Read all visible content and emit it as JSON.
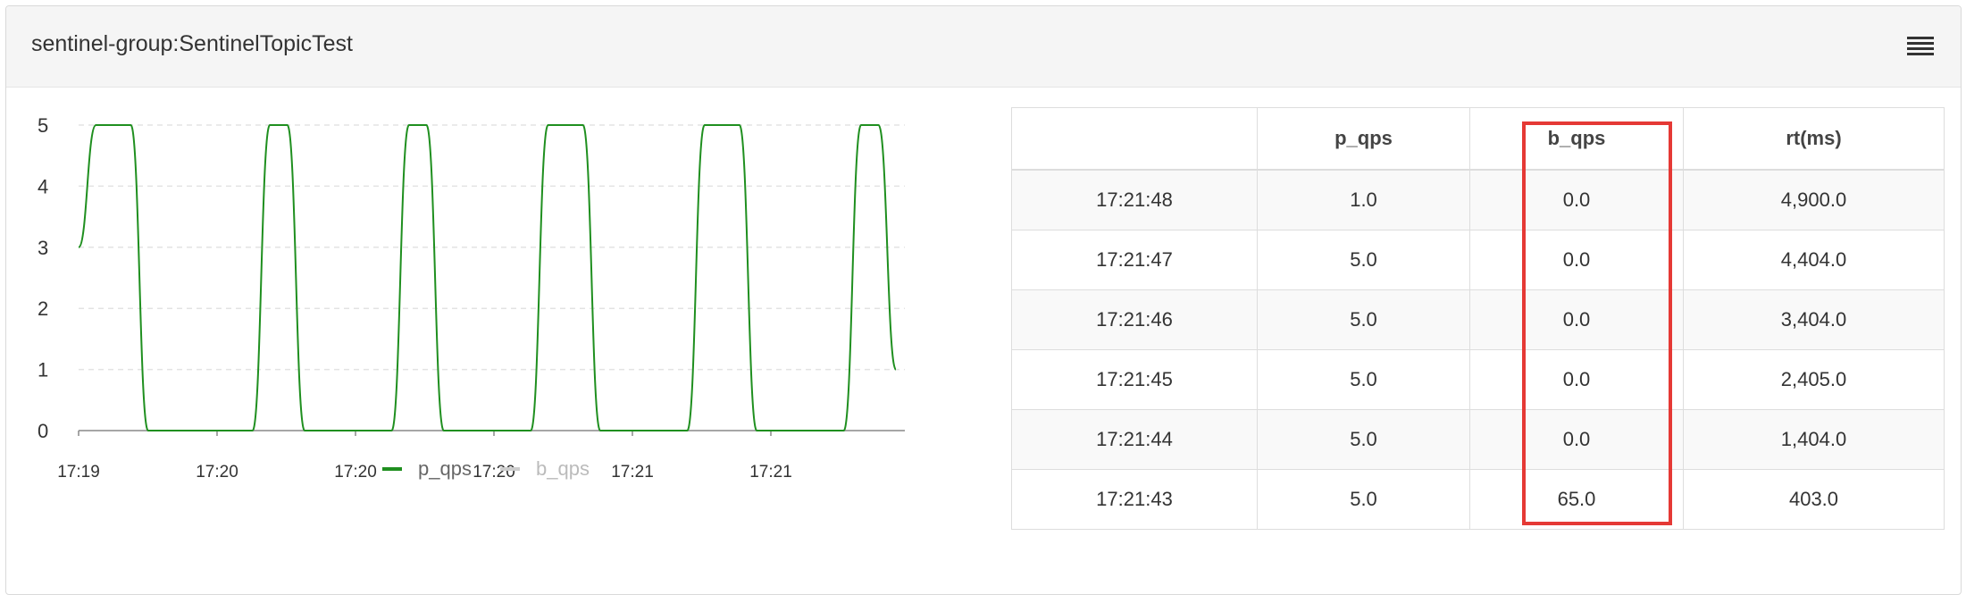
{
  "panel": {
    "title": "sentinel-group:SentinelTopicTest",
    "menu_icon": "hamburger-menu-icon"
  },
  "chart_data": {
    "type": "line",
    "x": [
      "17:19",
      "17:20",
      "17:20",
      "17:20",
      "17:21",
      "17:21"
    ],
    "ylim": [
      0,
      5
    ],
    "yticks": [
      0,
      1,
      2,
      3,
      4,
      5
    ],
    "grid": true,
    "legend": "bottom-center",
    "series": [
      {
        "name": "p_qps",
        "color": "#1f8f1f",
        "values": [
          3,
          5,
          5,
          5,
          0,
          0,
          0,
          0,
          0,
          0,
          0,
          5,
          5,
          0,
          0,
          0,
          0,
          0,
          0,
          5,
          5,
          0,
          0,
          0,
          0,
          0,
          0,
          5,
          5,
          5,
          0,
          0,
          0,
          0,
          0,
          0,
          5,
          5,
          5,
          0,
          0,
          0,
          0,
          0,
          0,
          5,
          5,
          1
        ],
        "visible": true
      },
      {
        "name": "b_qps",
        "color": "#cccccc",
        "values": [],
        "visible": false
      }
    ]
  },
  "table": {
    "headers": [
      "",
      "p_qps",
      "b_qps",
      "rt(ms)"
    ],
    "rows": [
      [
        "17:21:48",
        "1.0",
        "0.0",
        "4,900.0"
      ],
      [
        "17:21:47",
        "5.0",
        "0.0",
        "4,404.0"
      ],
      [
        "17:21:46",
        "5.0",
        "0.0",
        "3,404.0"
      ],
      [
        "17:21:45",
        "5.0",
        "0.0",
        "2,405.0"
      ],
      [
        "17:21:44",
        "5.0",
        "0.0",
        "1,404.0"
      ],
      [
        "17:21:43",
        "5.0",
        "65.0",
        "403.0"
      ]
    ],
    "highlight_color": "#e53935"
  }
}
